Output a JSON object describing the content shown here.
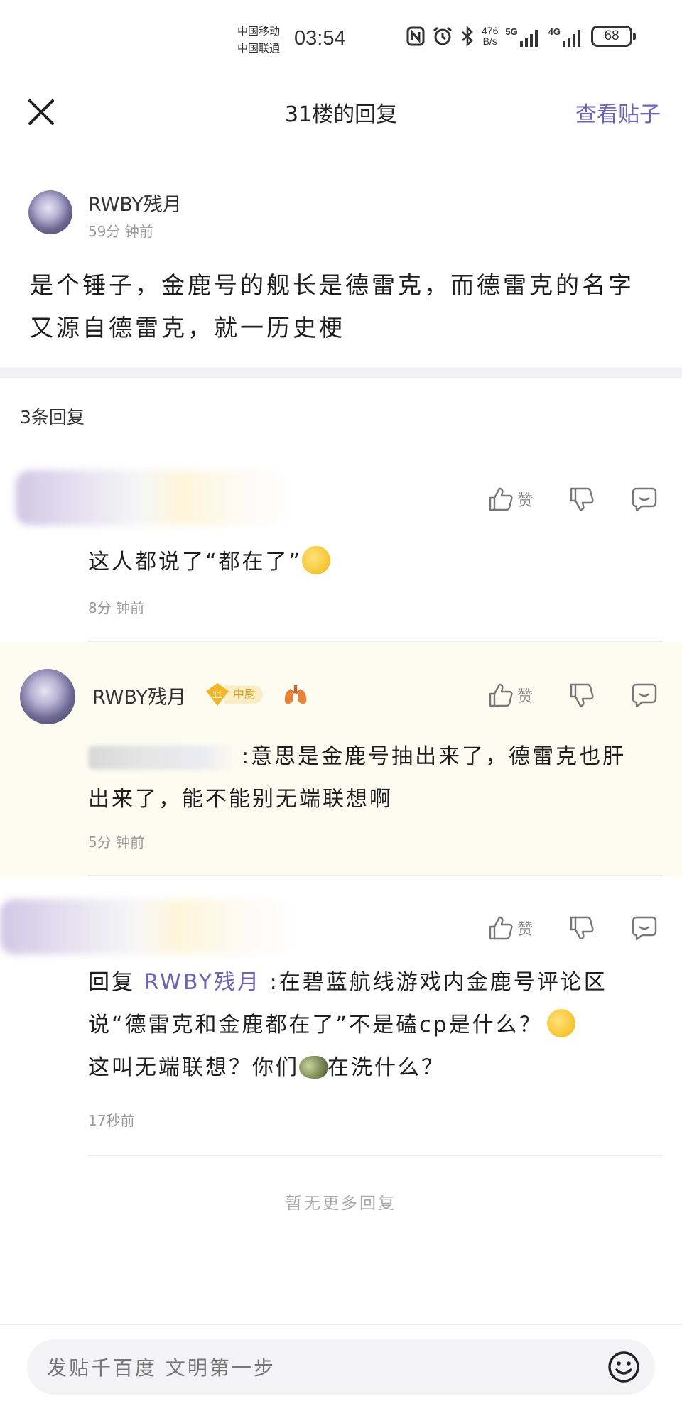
{
  "status_bar": {
    "carrier_1": "中国移动",
    "carrier_2": "中国联通",
    "time": "03:54",
    "net_speed_value": "476",
    "net_speed_unit": "B/s",
    "signal_1": "5G",
    "signal_2": "4G",
    "battery": "68"
  },
  "header": {
    "title": "31楼的回复",
    "view_post": "查看贴子",
    "close_icon": "close-icon"
  },
  "post": {
    "author": "RWBY残月",
    "time": "59分 钟前",
    "body": "是个锤子，金鹿号的舰长是德雷克，而德雷克的名字又源自德雷克，就一历史梗"
  },
  "reply_count": "3条回复",
  "like_label": "赞",
  "replies": [
    {
      "text": "这人都说了“都在了”",
      "time": "8分 钟前",
      "emoji": "sweat-emoji"
    },
    {
      "author": "RWBY残月",
      "level": "11",
      "title_badge": "中尉",
      "text": ":意思是金鹿号抽出来了，德雷克也肝出来了，能不能别无端联想啊",
      "time": "5分 钟前"
    },
    {
      "reply_prefix": "回复",
      "mention": "RWBY残月",
      "text_1": ":在碧蓝航线游戏内金鹿号评论区说“德雷克和金鹿都在了”不是磕cp是什么？",
      "text_2": "这叫无端联想？你们",
      "text_3": "在洗什么？",
      "time": "17秒前"
    }
  ],
  "no_more": "暂无更多回复",
  "input": {
    "placeholder": "发贴千百度 文明第一步"
  },
  "colors": {
    "accent": "#6b64b8",
    "highlight_bg": "#fdfcf0",
    "badge_gold": "#f2b629"
  }
}
